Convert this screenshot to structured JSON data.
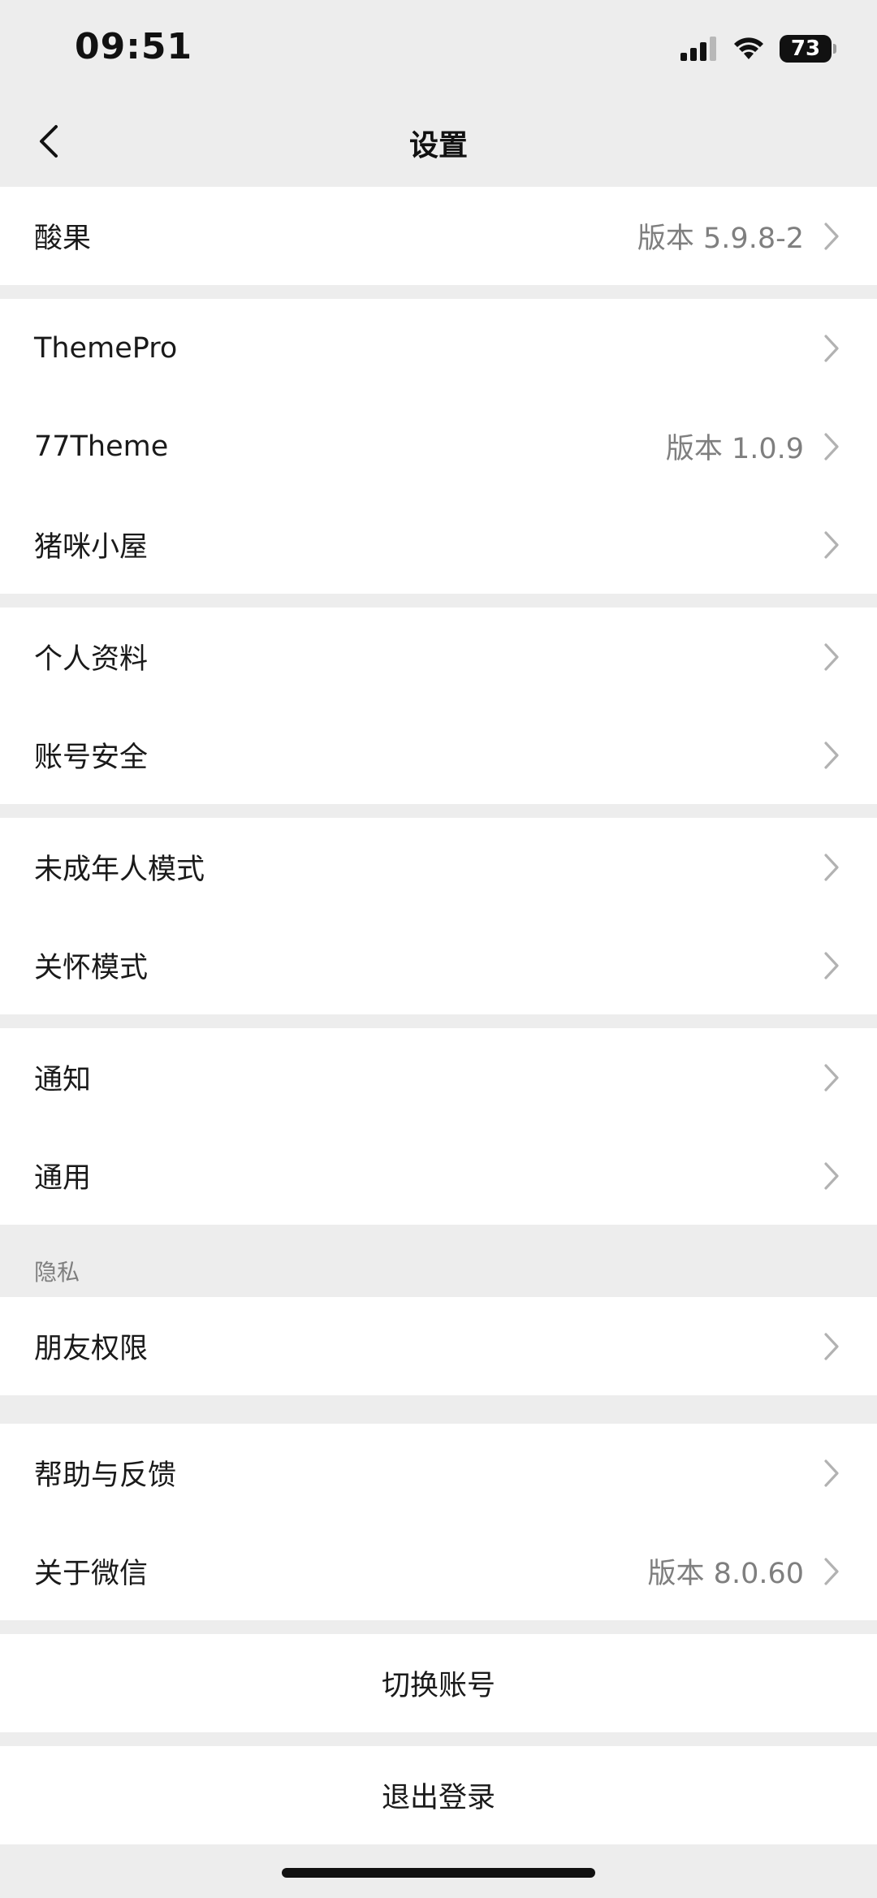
{
  "status_bar": {
    "time": "09:51",
    "battery": "73"
  },
  "nav": {
    "title": "设置"
  },
  "groups": [
    [
      {
        "label": "酸果",
        "value": "版本 5.9.8-2"
      }
    ],
    [
      {
        "label": "ThemePro",
        "value": ""
      },
      {
        "label": "77Theme",
        "value": "版本 1.0.9"
      },
      {
        "label": "猪咪小屋",
        "value": ""
      }
    ],
    [
      {
        "label": "个人资料",
        "value": ""
      },
      {
        "label": "账号安全",
        "value": ""
      }
    ],
    [
      {
        "label": "未成年人模式",
        "value": ""
      },
      {
        "label": "关怀模式",
        "value": ""
      }
    ],
    [
      {
        "label": "通知",
        "value": ""
      },
      {
        "label": "通用",
        "value": ""
      }
    ]
  ],
  "privacy": {
    "header": "隐私",
    "items": [
      {
        "label": "朋友权限",
        "value": ""
      }
    ]
  },
  "help_group": [
    {
      "label": "帮助与反馈",
      "value": ""
    },
    {
      "label": "关于微信",
      "value": "版本 8.0.60"
    }
  ],
  "actions": {
    "switch_account": "切换账号",
    "logout": "退出登录"
  },
  "colors": {
    "background": "#ededed",
    "cell": "#ffffff",
    "secondary_text": "#7f7f7f",
    "chevron": "#b2b2b2"
  }
}
